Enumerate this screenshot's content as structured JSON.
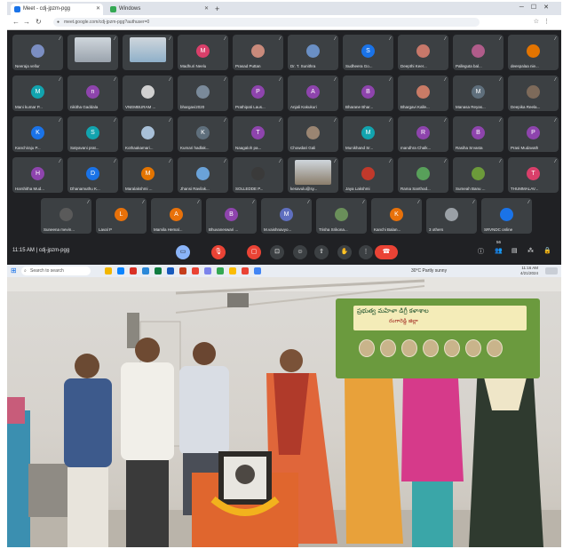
{
  "browser": {
    "tabs": [
      {
        "label": "Meet - cdj-jpzm-pgg",
        "active": true
      },
      {
        "label": "Windows",
        "active": false
      }
    ],
    "url": "meet.google.com/cdj-jpzm-pgg?authuser=0"
  },
  "meet": {
    "time": "11:15 AM",
    "separator": "|",
    "meeting_code": "cdj-jpzm-pgg",
    "participant_count": "56",
    "participants": [
      {
        "name": "Neeraja vellur",
        "avatar": "",
        "color": "#7b8ec2",
        "video": false
      },
      {
        "name": "",
        "avatar": "",
        "color": "#9aa3ad",
        "video": true
      },
      {
        "name": "",
        "avatar": "",
        "color": "#8fb0c9",
        "video": true
      },
      {
        "name": "Madhuri Neelu",
        "avatar": "M",
        "color": "#d93f6a",
        "video": false
      },
      {
        "name": "Prasad Puttan",
        "avatar": "",
        "color": "#c98a7b",
        "video": false
      },
      {
        "name": "Dr. T. Sunithra",
        "avatar": "",
        "color": "#6a8fc4",
        "video": false
      },
      {
        "name": "Sudheera Go...",
        "avatar": "S",
        "color": "#1a73e8",
        "video": false
      },
      {
        "name": "Deepthi Keer...",
        "avatar": "",
        "color": "#c7786a",
        "video": false
      },
      {
        "name": "Palleguta bal...",
        "avatar": "",
        "color": "#b05c8a",
        "video": false
      },
      {
        "name": "deespalaa nie...",
        "avatar": "",
        "color": "#e37400",
        "video": false
      },
      {
        "name": "Mani kumar P...",
        "avatar": "M",
        "color": "#12a4af",
        "video": false
      },
      {
        "name": "nikitha Gaddala",
        "avatar": "n",
        "color": "#8e44ad",
        "video": false
      },
      {
        "name": "VNEMBURAM ...",
        "avatar": "",
        "color": "#d0d0d0",
        "video": false
      },
      {
        "name": "bhargavi2020",
        "avatar": "",
        "color": "#7a8a9a",
        "video": false
      },
      {
        "name": "Prathipati Laus...",
        "avatar": "P",
        "color": "#8e44ad",
        "video": false
      },
      {
        "name": "Anjali Kakukuri",
        "avatar": "A",
        "color": "#8e44ad",
        "video": false
      },
      {
        "name": "Bharane Bhar...",
        "avatar": "B",
        "color": "#8e44ad",
        "video": false
      },
      {
        "name": "Bhargavi Kalle...",
        "avatar": "",
        "color": "#c97b66",
        "video": false
      },
      {
        "name": "Manasa Reyas...",
        "avatar": "M",
        "color": "#5f6f7c",
        "video": false
      },
      {
        "name": "Deepika Reela...",
        "avatar": "",
        "color": "#7d6a5a",
        "video": false
      },
      {
        "name": "Kanchiraju P...",
        "avatar": "K",
        "color": "#1a73e8",
        "video": false
      },
      {
        "name": "Satyavani prat...",
        "avatar": "S",
        "color": "#12a4af",
        "video": false
      },
      {
        "name": "Kothaakamari...",
        "avatar": "",
        "color": "#a8c0d8",
        "video": false
      },
      {
        "name": "Kumari hadlak...",
        "avatar": "K",
        "color": "#5f6f7c",
        "video": false
      },
      {
        "name": "Naagaloh pa...",
        "avatar": "T",
        "color": "#8e44ad",
        "video": false
      },
      {
        "name": "Chowdari Gali",
        "avatar": "",
        "color": "#9a8572",
        "video": false
      },
      {
        "name": "Munikhand Sr...",
        "avatar": "M",
        "color": "#12a4af",
        "video": false
      },
      {
        "name": "mandhra Chalk...",
        "avatar": "R",
        "color": "#8e44ad",
        "video": false
      },
      {
        "name": "Rasiha Srvasta",
        "avatar": "B",
        "color": "#8e44ad",
        "video": false
      },
      {
        "name": "Prasi Mudavath",
        "avatar": "P",
        "color": "#8e44ad",
        "video": false
      },
      {
        "name": "Harshitha Mud...",
        "avatar": "H",
        "color": "#8e44ad",
        "video": false
      },
      {
        "name": "Dhanamuthu K...",
        "avatar": "D",
        "color": "#1a73e8",
        "video": false
      },
      {
        "name": "Maralakshmi ...",
        "avatar": "M",
        "color": "#e37400",
        "video": false
      },
      {
        "name": "Jhansi Ravilak...",
        "avatar": "",
        "color": "#6aa2d8",
        "video": false
      },
      {
        "name": "SOLLEDDE P...",
        "avatar": "",
        "color": "#3a3a3a",
        "video": false
      },
      {
        "name": "kesavulu@sy...",
        "avatar": "",
        "color": "#8a7d6b",
        "video": true
      },
      {
        "name": "Jaya Lakshmi",
        "avatar": "",
        "color": "#c0392b",
        "video": false
      },
      {
        "name": "Rama Santhod...",
        "avatar": "",
        "color": "#58a05a",
        "video": false
      },
      {
        "name": "Sumeah Banu ...",
        "avatar": "",
        "color": "#6c9a3a",
        "video": false
      },
      {
        "name": "THUMMALAV...",
        "avatar": "T",
        "color": "#d93f6a",
        "video": false
      },
      {
        "name": "Suneena mevin...",
        "avatar": "",
        "color": "#5a5a5a",
        "video": false
      },
      {
        "name": "Laval P",
        "avatar": "L",
        "color": "#e8710a",
        "video": false
      },
      {
        "name": "Mamila Hemal...",
        "avatar": "A",
        "color": "#e8710a",
        "video": false
      },
      {
        "name": "Bhuvaneswari ...",
        "avatar": "B",
        "color": "#8e44ad",
        "video": false
      },
      {
        "name": "M.vaishnavyo...",
        "avatar": "M",
        "color": "#5f6fbf",
        "video": false
      },
      {
        "name": "Trisha Srikona...",
        "avatar": "",
        "color": "#6a8f5a",
        "video": false
      },
      {
        "name": "Kanchi Balan...",
        "avatar": "K",
        "color": "#e8710a",
        "video": false
      },
      {
        "name": "3 others",
        "avatar": "",
        "color": "#9aa0a6",
        "video": false
      },
      {
        "name": "SRVNDC online",
        "avatar": "",
        "color": "#1a73e8",
        "video": false
      }
    ]
  },
  "taskbar": {
    "search_placeholder": "Search to search",
    "weather": "30°C Partly sunny",
    "clock_time": "11:16 AM",
    "clock_date": "4/21/2024"
  },
  "banner": {
    "line1": "ప్రభుత్వ మహిళా డిగ్రీ కళాశాల",
    "line2": "రంగారెడ్డి జిల్లా"
  }
}
